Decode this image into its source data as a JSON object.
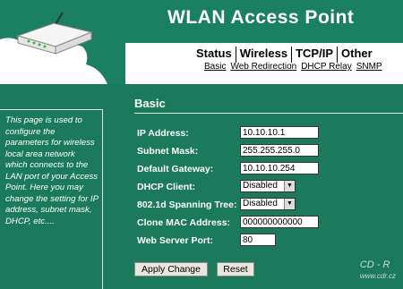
{
  "header": {
    "title": "WLAN Access Point"
  },
  "nav": {
    "tabs": [
      "Status",
      "Wireless",
      "TCP/IP",
      "Other"
    ],
    "subnav": [
      "Basic",
      "Web Redirection",
      "DHCP Relay",
      "SNMP"
    ]
  },
  "left_panel": {
    "text": "This page is used to configure the parameters for wireless local area network which connects to the LAN port of your Access Point. Here you may change the setting for IP address, subnet mask, DHCP, etc...."
  },
  "section": {
    "title": "Basic"
  },
  "form": {
    "ip_label": "IP Address:",
    "ip_value": "10.10.10.1",
    "mask_label": "Subnet Mask:",
    "mask_value": "255.255.255.0",
    "gateway_label": "Default Gateway:",
    "gateway_value": "10.10.10.254",
    "dhcp_label": "DHCP Client:",
    "dhcp_value": "Disabled",
    "stp_label": "802.1d Spanning Tree:",
    "stp_value": "Disabled",
    "mac_label": "Clone MAC Address:",
    "mac_value": "000000000000",
    "port_label": "Web Server Port:",
    "port_value": "80"
  },
  "buttons": {
    "apply": "Apply Change",
    "reset": "Reset"
  },
  "watermark": {
    "brand": "CD - R",
    "url": "www.cdr.cz"
  },
  "colors": {
    "panel": "#1a7a5b",
    "header_band": "#1b7f61"
  }
}
